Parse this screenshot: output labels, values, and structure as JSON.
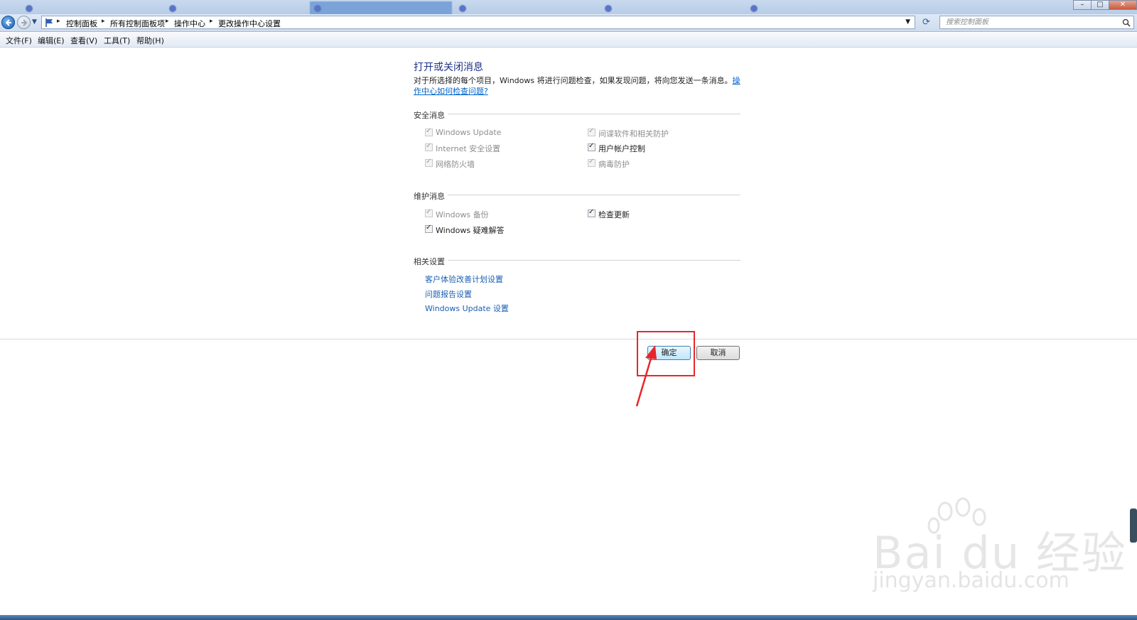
{
  "browser": {
    "tabs": [
      "",
      "",
      "",
      "",
      "",
      ""
    ]
  },
  "address": {
    "crumbs": [
      "控制面板",
      "所有控制面板项",
      "操作中心",
      "更改操作中心设置"
    ],
    "search_placeholder": "搜索控制面板"
  },
  "menu": [
    "文件(F)",
    "编辑(E)",
    "查看(V)",
    "工具(T)",
    "帮助(H)"
  ],
  "page": {
    "title": "打开或关闭消息",
    "desc_text": "对于所选择的每个项目，Windows 将进行问题检查，如果发现问题，将向您发送一条消息。",
    "desc_link": "操作中心如何检查问题?"
  },
  "security": {
    "heading": "安全消息",
    "items": [
      {
        "label": "Windows Update",
        "checked": true,
        "enabled": false
      },
      {
        "label": "间谍软件和相关防护",
        "checked": true,
        "enabled": false
      },
      {
        "label": "Internet 安全设置",
        "checked": true,
        "enabled": false
      },
      {
        "label": "用户帐户控制",
        "checked": true,
        "enabled": true
      },
      {
        "label": "网络防火墙",
        "checked": true,
        "enabled": false
      },
      {
        "label": "病毒防护",
        "checked": true,
        "enabled": false
      }
    ]
  },
  "maintenance": {
    "heading": "维护消息",
    "items": [
      {
        "label": "Windows 备份",
        "checked": true,
        "enabled": false
      },
      {
        "label": "检查更新",
        "checked": true,
        "enabled": true
      },
      {
        "label": "Windows 疑难解答",
        "checked": true,
        "enabled": true
      }
    ]
  },
  "related": {
    "heading": "相关设置",
    "links": [
      "客户体验改善计划设置",
      "问题报告设置",
      "Windows Update 设置"
    ]
  },
  "buttons": {
    "ok": "确定",
    "cancel": "取消"
  },
  "watermark": {
    "brand": "Bai du 经验",
    "url": "jingyan.baidu.com"
  }
}
